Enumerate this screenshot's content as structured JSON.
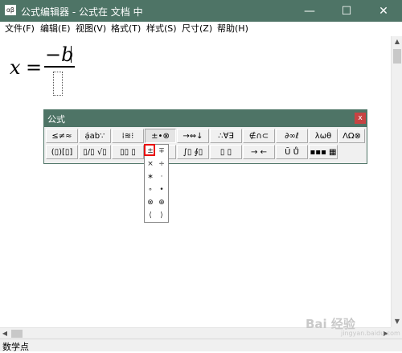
{
  "window": {
    "icon_text": "αβ",
    "title": "公式编辑器 - 公式在 文档 中",
    "buttons": {
      "minimize": "—",
      "maximize": "☐",
      "close": "✕"
    }
  },
  "menu": [
    "文件(F)",
    "编辑(E)",
    "视图(V)",
    "格式(T)",
    "样式(S)",
    "尺寸(Z)",
    "帮助(H)"
  ],
  "equation": {
    "lhs": "x",
    "op": "=",
    "numerator": "−b"
  },
  "palette": {
    "title": "公式",
    "close": "x",
    "row1": [
      "≤≠≈",
      "ạ̇ab∵",
      "⁞≋⁝",
      "±•⊗",
      "→⇔↓",
      "∴∀∃",
      "∉∩⊂",
      "∂∞ℓ",
      "λωθ",
      "ΛΩ⊗"
    ],
    "row2": [
      "(▯)[▯]",
      "▯/▯ √▯",
      "▯▯ ▯",
      "±∓",
      "∫▯ ∮▯",
      "▯ ▯",
      "→ ←",
      "Ū Ů",
      "▪▪▪ ▦"
    ]
  },
  "dropdown": {
    "rows": [
      [
        "±",
        "∓"
      ],
      [
        "×",
        "÷"
      ],
      [
        "∗",
        "·"
      ],
      [
        "∘",
        "•"
      ],
      [
        "⊗",
        "⊕"
      ],
      [
        "⟨",
        "⟩"
      ]
    ]
  },
  "statusbar": {
    "text": "数学点"
  },
  "scroll": {
    "up": "▲",
    "down": "▼",
    "left": "◀",
    "right": "▶"
  },
  "watermark": {
    "brand": "Bai 经验",
    "sub": "jingyan.baidu.com"
  },
  "colors": {
    "titlebar": "#4e7466",
    "highlight": "#e81010",
    "close": "#c74343"
  }
}
